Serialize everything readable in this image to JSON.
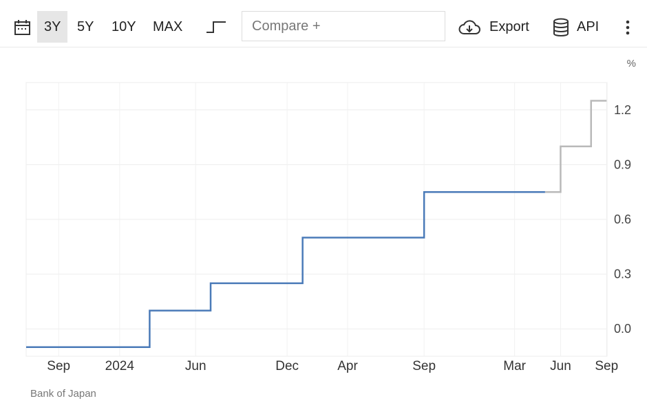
{
  "toolbar": {
    "ranges": [
      "3Y",
      "5Y",
      "10Y",
      "MAX"
    ],
    "active_range": "3Y",
    "compare_placeholder": "Compare +",
    "export_label": "Export",
    "api_label": "API",
    "icons": [
      "calendar-icon",
      "step-line-icon",
      "cloud-download-icon",
      "database-icon",
      "more-vertical-icon"
    ]
  },
  "chart_data": {
    "type": "line",
    "style": "step",
    "unit_label": "%",
    "x_tick_labels": [
      "Sep",
      "2024",
      "Jun",
      "Dec",
      "Apr",
      "Sep",
      "Mar",
      "Jun",
      "Sep"
    ],
    "y_tick_labels": [
      "1.2",
      "0.9",
      "0.6",
      "0.3",
      "0.0"
    ],
    "ylim": [
      -0.15,
      1.35
    ],
    "grid": true,
    "colors": {
      "history": "#4a7ab8",
      "forecast": "#b9b9b9"
    },
    "series": [
      {
        "segment": "history",
        "x": [
          "2023-07",
          "2024-03",
          "2024-07",
          "2024-12",
          "2025-01",
          "2025-09",
          "2025-12",
          "2026-05"
        ],
        "y": [
          -0.1,
          0.1,
          0.25,
          0.25,
          0.5,
          0.75,
          0.75,
          0.75
        ]
      },
      {
        "segment": "forecast",
        "x": [
          "2026-05",
          "2026-06",
          "2026-07",
          "2026-08",
          "2026-09"
        ],
        "y": [
          0.75,
          1.0,
          1.0,
          1.25,
          1.25
        ]
      }
    ]
  },
  "footer": {
    "source": "Bank of Japan"
  }
}
